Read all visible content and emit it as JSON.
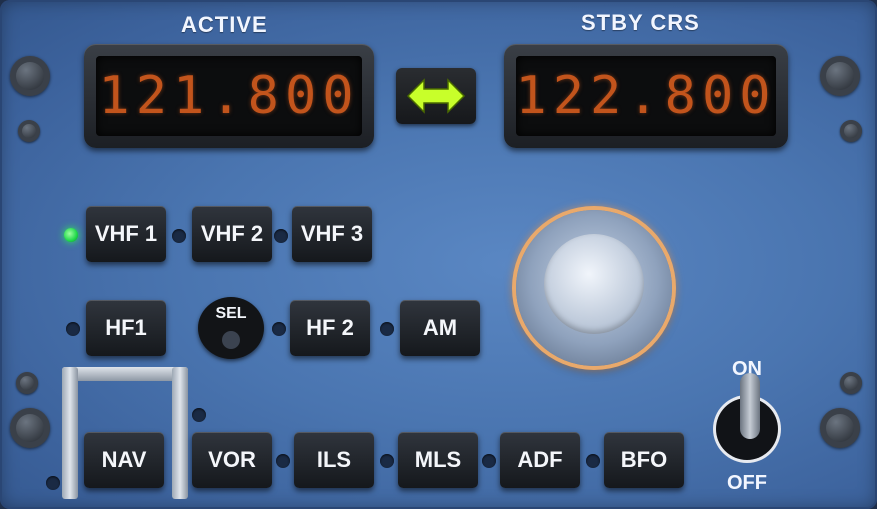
{
  "headers": {
    "active": "ACTIVE",
    "stby": "STBY CRS"
  },
  "displays": {
    "active_freq": "121.800",
    "stby_freq": "122.800"
  },
  "transfer": {
    "icon": "swap-arrows-icon",
    "color": "#c8ff2a"
  },
  "buttons": {
    "vhf1": "VHF 1",
    "vhf2": "VHF 2",
    "vhf3": "VHF 3",
    "hf1": "HF1",
    "hf2": "HF 2",
    "am": "AM",
    "nav": "NAV",
    "vor": "VOR",
    "ils": "ILS",
    "mls": "MLS",
    "adf": "ADF",
    "bfo": "BFO"
  },
  "sel_label": "SEL",
  "toggle": {
    "on": "ON",
    "off": "OFF"
  },
  "indicators": {
    "vhf1_active": true,
    "active_color": "#2ef05c",
    "display_color": "#c2541c"
  }
}
